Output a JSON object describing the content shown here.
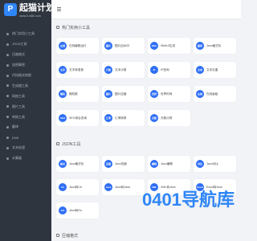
{
  "logo": {
    "title": "起猫计划",
    "subtitle": "www.1x68.com"
  },
  "sidebar": {
    "items": [
      {
        "label": "热门实用小工具"
      },
      {
        "label": "JSON工具"
      },
      {
        "label": "压缩格式"
      },
      {
        "label": "加密解密"
      },
      {
        "label": "代码格式转换"
      },
      {
        "label": "生成器工具"
      },
      {
        "label": "网络工具"
      },
      {
        "label": "图片工具"
      },
      {
        "label": "转换工具"
      },
      {
        "label": "翻译"
      },
      {
        "label": "DNS"
      },
      {
        "label": "文本处理"
      },
      {
        "label": "计算器"
      }
    ]
  },
  "sections": [
    {
      "title": "热门实用小工具",
      "cards": [
        {
          "icon_text": "在线",
          "label": "在线编程运行",
          "color": "#2f6ff6"
        },
        {
          "icon_text": "图片",
          "label": "图片加水印",
          "color": "#2f6ff6"
        },
        {
          "icon_text": "Web",
          "label": "WebUI生成",
          "color": "#2f6ff6"
        },
        {
          "icon_text": "图床",
          "label": "Json格式化",
          "color": "#2f6ff6"
        },
        {
          "icon_text": "文字",
          "label": "文字转语音",
          "color": "#2f6ff6"
        },
        {
          "icon_text": "计数",
          "label": "文本计数",
          "color": "#2f6ff6"
        },
        {
          "icon_text": "IP",
          "label": "IP查询",
          "color": "#2f6ff6"
        },
        {
          "icon_text": "文本",
          "label": "文本去重",
          "color": "#2f6ff6"
        },
        {
          "icon_text": "随机",
          "label": "随机数",
          "color": "#2f6ff6"
        },
        {
          "icon_text": "图片",
          "label": "图片压缩",
          "color": "#2f6ff6"
        },
        {
          "icon_text": "世界",
          "label": "世界时间",
          "color": "#2f6ff6"
        },
        {
          "icon_text": "在线",
          "label": "在线画板",
          "color": "#2f6ff6"
        },
        {
          "icon_text": "SEO",
          "label": "SEO综合查询",
          "color": "#2f6ff6"
        },
        {
          "icon_text": "汇率",
          "label": "汇率换算",
          "color": "#2f6ff6"
        },
        {
          "icon_text": "天数",
          "label": "天数计算",
          "color": "#2f6ff6"
        }
      ]
    },
    {
      "title": "JSON工具",
      "cards": [
        {
          "icon_text": "格式",
          "label": "Json格式化",
          "color": "#2f6ff6"
        },
        {
          "icon_text": "压缩",
          "label": "Json压缩",
          "color": "#2f6ff6"
        },
        {
          "icon_text": "编辑",
          "label": "Json编辑",
          "color": "#2f6ff6"
        },
        {
          "icon_text": "对比",
          "label": "Json对比",
          "color": "#2f6ff6"
        },
        {
          "icon_text": "C#",
          "label": "Json转C#",
          "color": "#2f6ff6"
        },
        {
          "icon_text": "Java",
          "label": "Json转Java",
          "color": "#2f6ff6"
        },
        {
          "icon_text": "XML",
          "label": "XML转Json",
          "color": "#2f6ff6"
        },
        {
          "icon_text": "Excel",
          "label": "Excel转Json",
          "color": "#2f6ff6"
        },
        {
          "icon_text": "GO",
          "label": "Json转Go",
          "color": "#2f6ff6"
        }
      ]
    },
    {
      "title": "压缩格式",
      "cards": []
    }
  ],
  "watermark": "0401导航库"
}
